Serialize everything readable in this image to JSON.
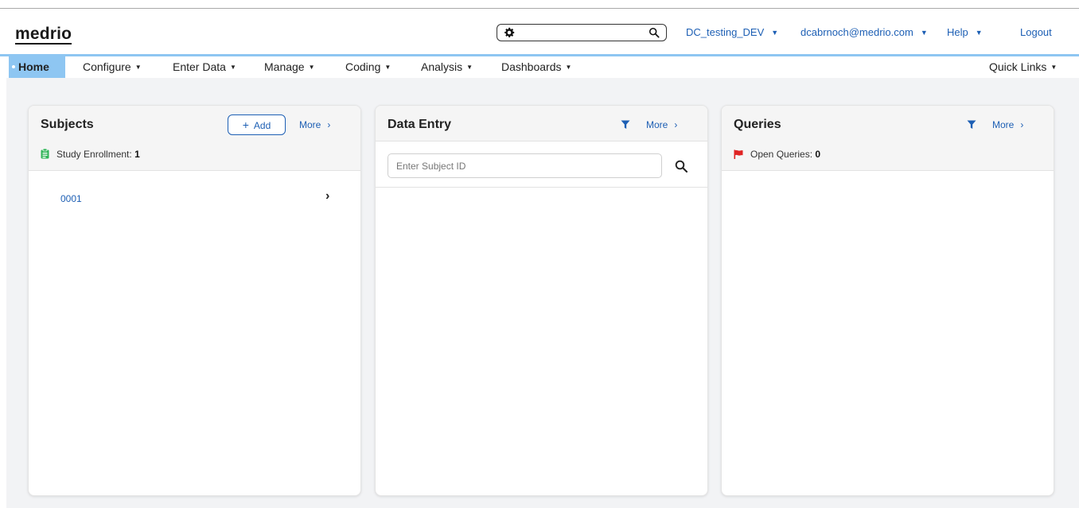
{
  "brand": {
    "logo_text": "medrio"
  },
  "header": {
    "search": {
      "value": "",
      "placeholder": ""
    },
    "study": "DC_testing_DEV",
    "user": "dcabrnoch@medrio.com",
    "help": "Help",
    "logout": "Logout"
  },
  "nav": {
    "items": [
      {
        "label": "Home",
        "active": true
      },
      {
        "label": "Configure"
      },
      {
        "label": "Enter Data"
      },
      {
        "label": "Manage"
      },
      {
        "label": "Coding"
      },
      {
        "label": "Analysis"
      },
      {
        "label": "Dashboards"
      }
    ],
    "quick_links": "Quick Links"
  },
  "panels": {
    "subjects": {
      "title": "Subjects",
      "add_label": "Add",
      "more_label": "More",
      "enrollment_label": "Study Enrollment:",
      "enrollment_count": "1",
      "items": [
        {
          "id": "0001"
        }
      ]
    },
    "data_entry": {
      "title": "Data Entry",
      "more_label": "More",
      "input_placeholder": "Enter Subject ID"
    },
    "queries": {
      "title": "Queries",
      "more_label": "More",
      "open_label": "Open Queries:",
      "open_count": "0"
    }
  },
  "colors": {
    "accent": "#1d5fb4",
    "nav_active": "#8ec6f2",
    "enrollment_icon": "#2fb457",
    "flag_icon": "#e02424"
  },
  "icons": {
    "search": "search-icon",
    "settings": "gear-icon",
    "filter": "filter-icon",
    "flag": "flag-icon",
    "clipboard": "clipboard-icon",
    "chevron": "chevron-right-icon",
    "caret": "caret-down-icon"
  }
}
